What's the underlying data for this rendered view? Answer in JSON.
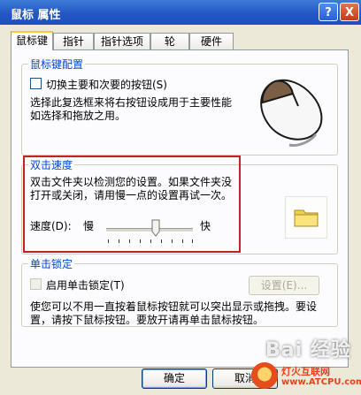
{
  "window": {
    "title": "鼠标 属性",
    "help_button": "?",
    "close_button": "X"
  },
  "tabs": [
    {
      "label": "鼠标键"
    },
    {
      "label": "指针"
    },
    {
      "label": "指针选项"
    },
    {
      "label": "轮"
    },
    {
      "label": "硬件"
    }
  ],
  "button_config": {
    "group_label": "鼠标键配置",
    "switch_label": "切换主要和次要的按钮(S)",
    "switch_checked": false,
    "description": [
      "选择此复选框来将右按钮设成用于主要性能",
      "如选择和拖放之用。"
    ],
    "mouse_icon": "mouse-icon"
  },
  "double_click": {
    "group_label": "双击速度",
    "description": [
      "双击文件夹以检测您的设置。如果文件夹没",
      "打开或关闭，请用慢一点的设置再试一次。"
    ],
    "speed_label": "速度(D):",
    "slow_label": "慢",
    "fast_label": "快",
    "speed_level": 0.55,
    "folder_icon": "folder-icon",
    "highlight_color": "#c42121"
  },
  "click_lock": {
    "group_label": "单击锁定",
    "enable_label": "启用单击锁定(T)",
    "enable_checked": false,
    "settings_button": "设置(E)...",
    "description": [
      "使您可以不用一直按着鼠标按钮就可以突出显示或拖拽。要设",
      "置，请按下鼠标按钮。要放开请再单击鼠标按钮。"
    ]
  },
  "footer": {
    "ok_button": "确定",
    "cancel_button": "取消"
  },
  "watermark": {
    "text": "Bai 经验",
    "site_name": "灯火互联网",
    "site_url": "www.ATCPU.com"
  }
}
